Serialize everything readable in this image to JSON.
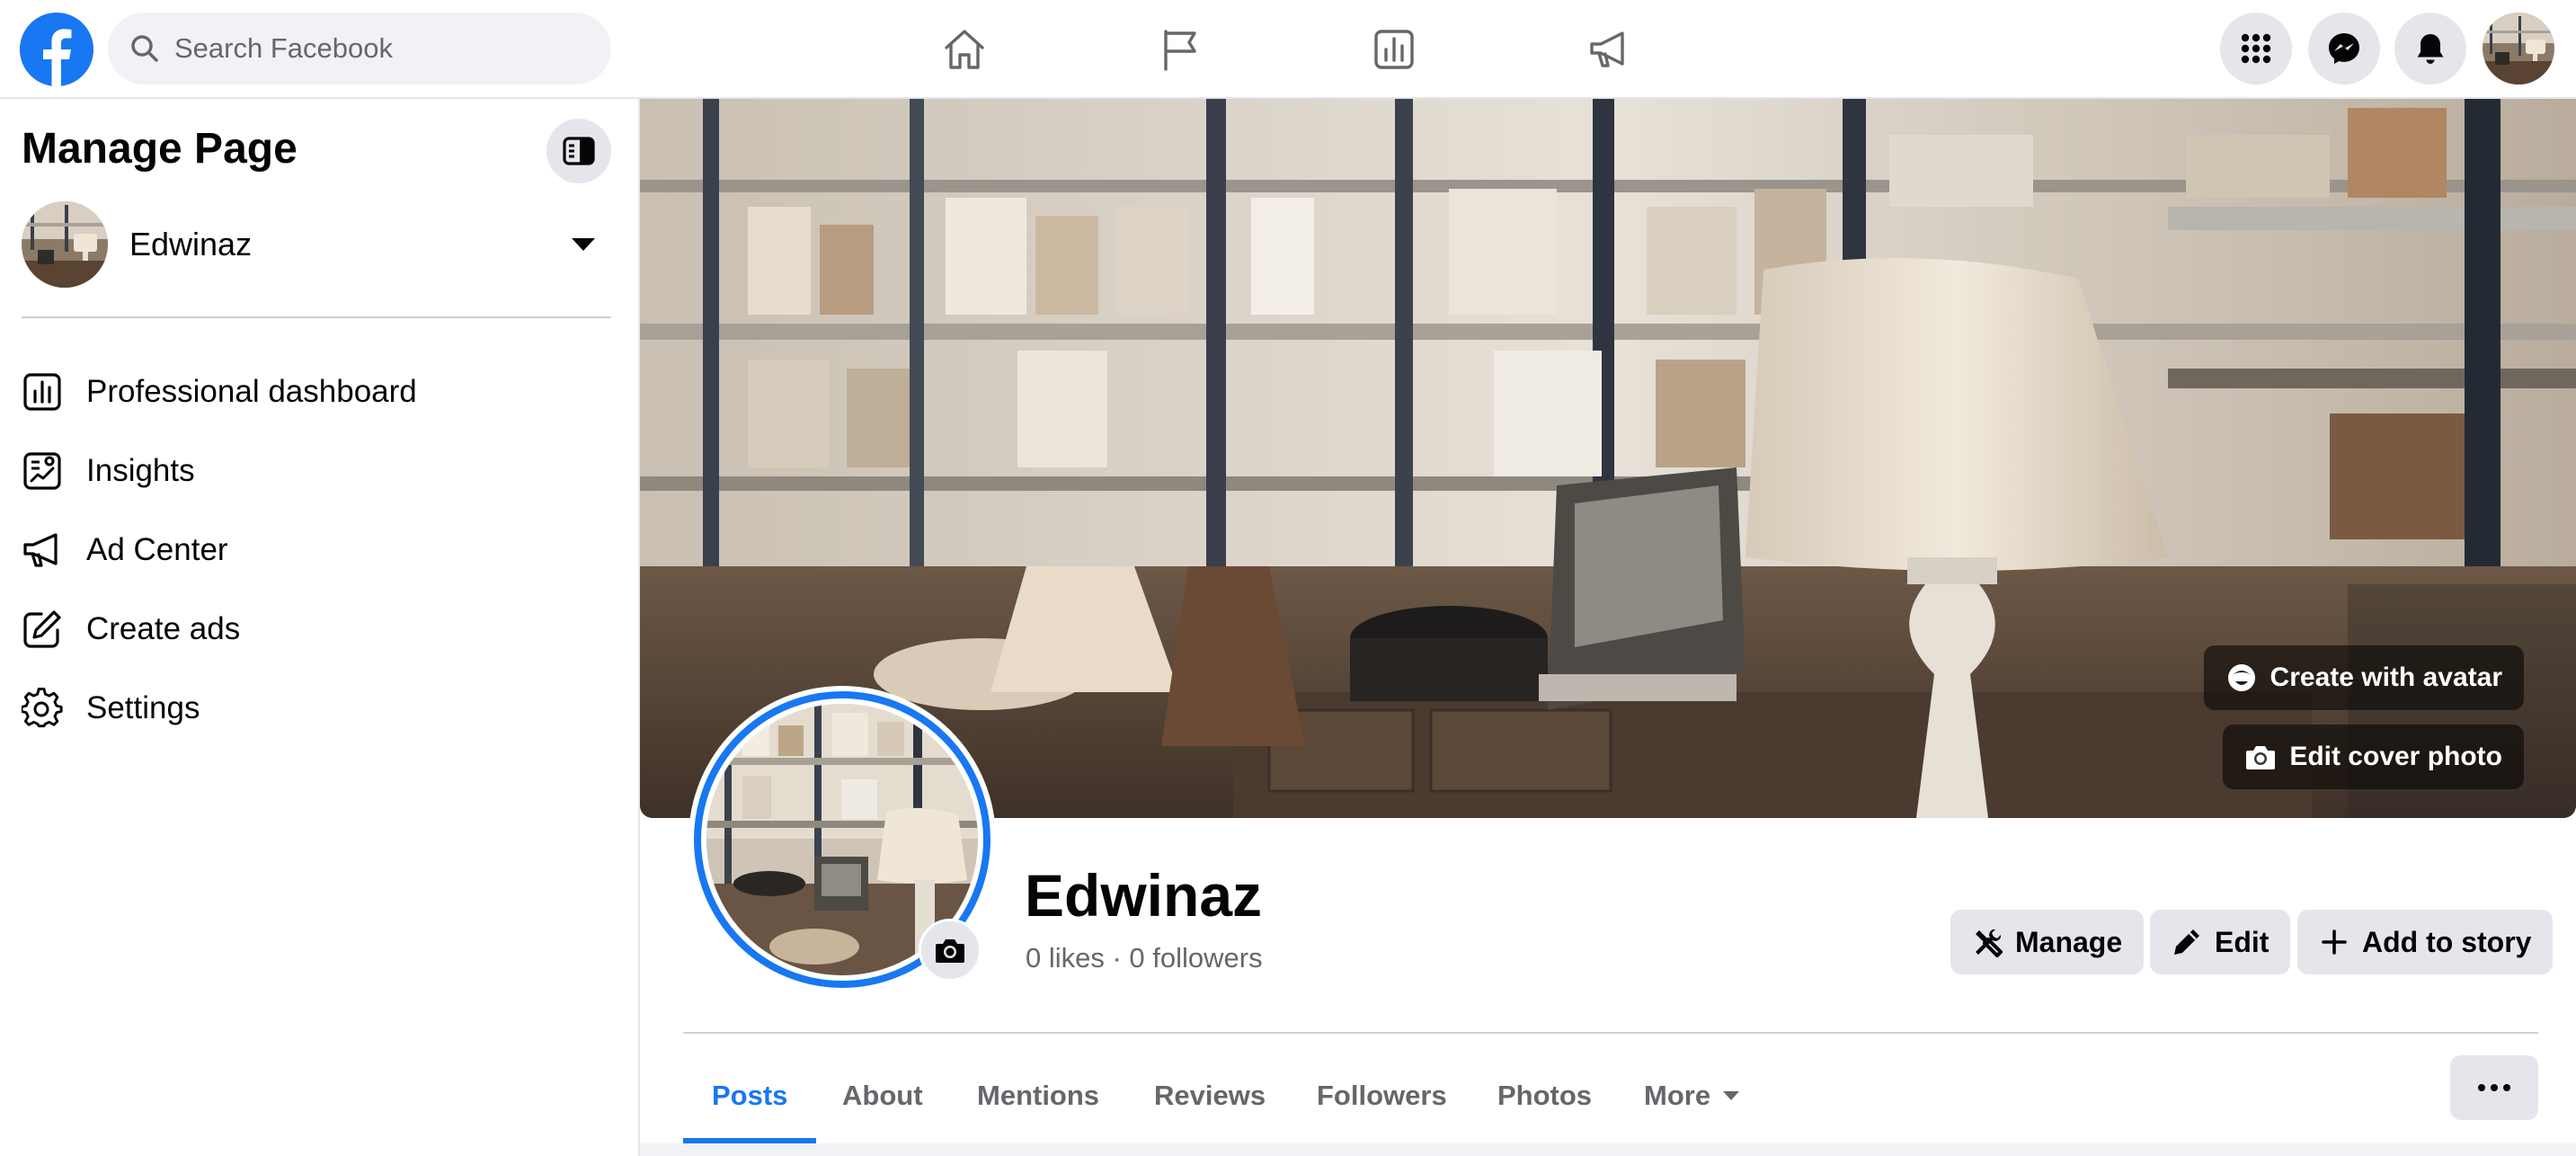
{
  "topbar": {
    "search_placeholder": "Search Facebook",
    "nav_icons": [
      "home-icon",
      "flag-icon",
      "dashboard-icon",
      "megaphone-icon"
    ],
    "right_icons": [
      "menu-grid-icon",
      "messenger-icon",
      "bell-icon"
    ]
  },
  "sidebar": {
    "title": "Manage Page",
    "page_name": "Edwinaz",
    "items": [
      {
        "label": "Professional dashboard",
        "icon": "dashboard-icon"
      },
      {
        "label": "Insights",
        "icon": "insights-icon"
      },
      {
        "label": "Ad Center",
        "icon": "megaphone-icon"
      },
      {
        "label": "Create ads",
        "icon": "edit-icon"
      },
      {
        "label": "Settings",
        "icon": "gear-icon"
      }
    ]
  },
  "cover": {
    "create_avatar_label": "Create with avatar",
    "edit_cover_label": "Edit cover photo"
  },
  "profile": {
    "name": "Edwinaz",
    "stats": "0 likes · 0 followers",
    "manage_label": "Manage",
    "edit_label": "Edit",
    "add_story_label": "Add to story"
  },
  "tabs": [
    {
      "label": "Posts",
      "active": true
    },
    {
      "label": "About"
    },
    {
      "label": "Mentions"
    },
    {
      "label": "Reviews"
    },
    {
      "label": "Followers"
    },
    {
      "label": "Photos"
    },
    {
      "label": "More"
    }
  ],
  "colors": {
    "brand": "#1877f2",
    "button_bg": "#e4e6eb",
    "secondary_text": "#65676b"
  }
}
